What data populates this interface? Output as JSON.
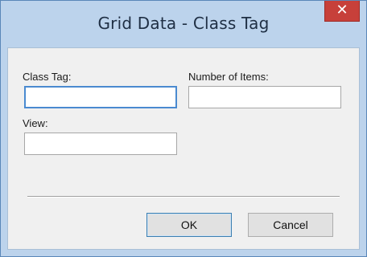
{
  "window": {
    "title": "Grid Data - Class Tag",
    "close_glyph": "✕"
  },
  "form": {
    "class_tag_label": "Class Tag:",
    "class_tag_value": "",
    "number_of_items_label": "Number of Items:",
    "number_of_items_value": "",
    "view_label": "View:",
    "view_value": ""
  },
  "buttons": {
    "ok_label": "OK",
    "cancel_label": "Cancel"
  },
  "colors": {
    "titlebar": "#bcd3ec",
    "close_button": "#c7403a",
    "focus_border": "#4a8ad0"
  }
}
